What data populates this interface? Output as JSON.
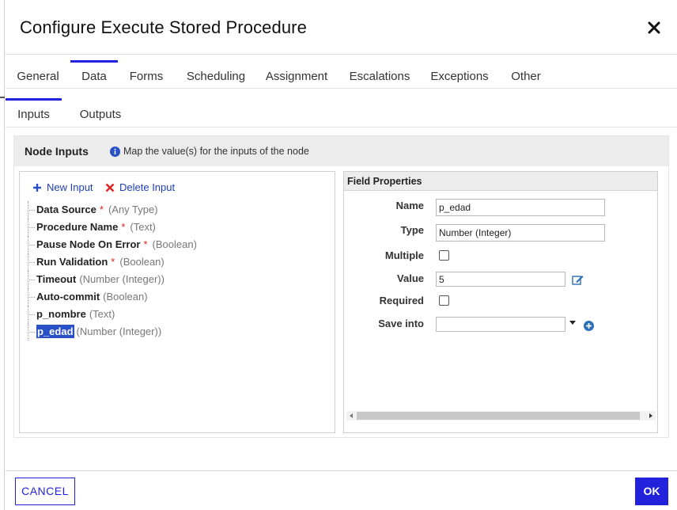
{
  "dialog": {
    "title": "Configure Execute Stored Procedure",
    "close_icon": "close-icon"
  },
  "tabs": [
    {
      "label": "General"
    },
    {
      "label": "Data",
      "active": true
    },
    {
      "label": "Forms"
    },
    {
      "label": "Scheduling"
    },
    {
      "label": "Assignment"
    },
    {
      "label": "Escalations"
    },
    {
      "label": "Exceptions"
    },
    {
      "label": "Other"
    }
  ],
  "subtabs": [
    {
      "label": "Inputs",
      "active": true
    },
    {
      "label": "Outputs"
    }
  ],
  "node_inputs": {
    "title": "Node Inputs",
    "info_text": "Map the value(s) for the inputs of the node",
    "info_icon": "info-icon",
    "actions": {
      "new_input": "New Input",
      "delete_input": "Delete Input"
    },
    "items": [
      {
        "name": "Data Source",
        "required": "*",
        "type": "(Any Type)"
      },
      {
        "name": "Procedure Name",
        "required": "*",
        "type": "(Text)"
      },
      {
        "name": "Pause Node On Error",
        "required": "*",
        "type": "(Boolean)"
      },
      {
        "name": "Run Validation",
        "required": "*",
        "type": "(Boolean)"
      },
      {
        "name": "Timeout",
        "required": "",
        "type": "(Number (Integer))"
      },
      {
        "name": "Auto-commit",
        "required": "",
        "type": "(Boolean)"
      },
      {
        "name": "p_nombre",
        "required": "",
        "type": "(Text)"
      },
      {
        "name": "p_edad",
        "required": "",
        "type": "(Number (Integer))",
        "selected": true
      }
    ]
  },
  "field_properties": {
    "title": "Field Properties",
    "name_label": "Name",
    "name_value": "p_edad",
    "type_label": "Type",
    "type_value": "Number (Integer)",
    "multiple_label": "Multiple",
    "multiple_checked": false,
    "value_label": "Value",
    "value_value": "5",
    "required_label": "Required",
    "required_checked": false,
    "save_into_label": "Save into",
    "save_into_value": ""
  },
  "footer": {
    "cancel_label": "CANCEL",
    "ok_label": "OK"
  },
  "colors": {
    "accent": "#2222dd",
    "link": "#1f3fb8",
    "required": "#dd2222",
    "selected_bg": "#2a50c8"
  }
}
